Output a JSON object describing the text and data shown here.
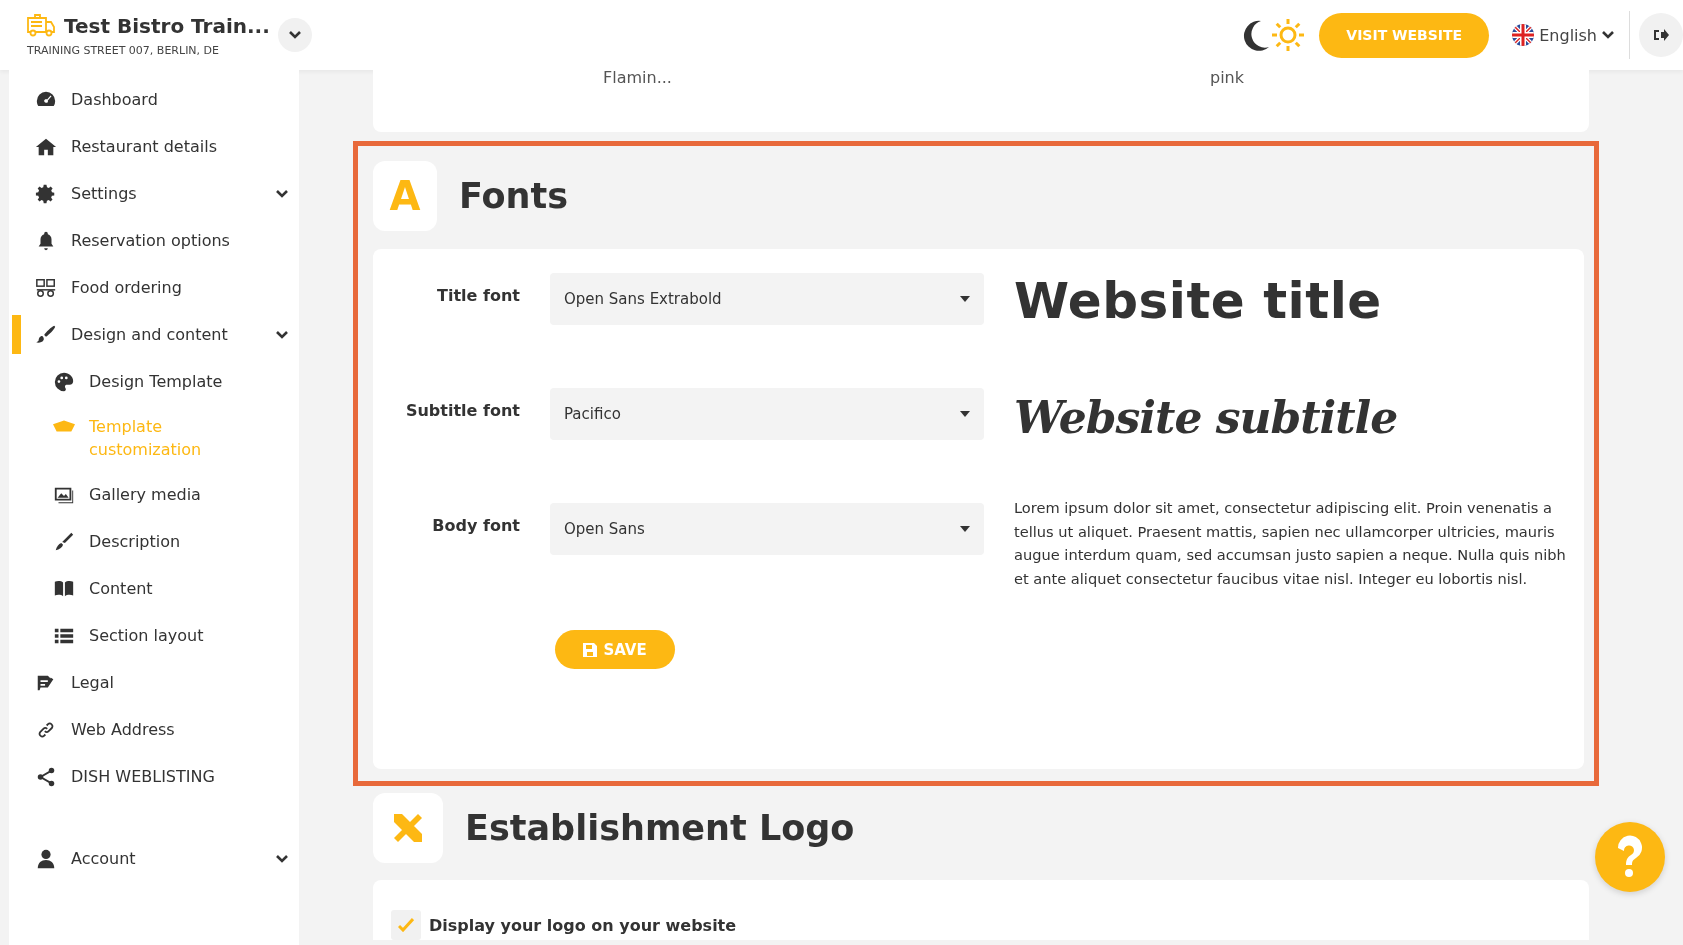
{
  "header": {
    "title": "Test Bistro Train...",
    "address": "TRAINING STREET 007, BERLIN, DE",
    "visit_button": "VISIT WEBSITE",
    "language": "English"
  },
  "sidebar": {
    "items": [
      {
        "label": "Dashboard",
        "selected": false,
        "dropdown": false
      },
      {
        "label": "Restaurant details",
        "selected": false,
        "dropdown": false
      },
      {
        "label": "Settings",
        "selected": false,
        "dropdown": true
      },
      {
        "label": "Reservation options",
        "selected": false,
        "dropdown": false
      },
      {
        "label": "Food ordering",
        "selected": false,
        "dropdown": false
      },
      {
        "label": "Design and content",
        "selected": true,
        "dropdown": true,
        "children": [
          {
            "label": "Design Template",
            "selected": false
          },
          {
            "label": "Template customization",
            "selected": true
          },
          {
            "label": "Gallery media",
            "selected": false
          },
          {
            "label": "Description",
            "selected": false
          },
          {
            "label": "Content",
            "selected": false
          },
          {
            "label": "Section layout",
            "selected": false
          }
        ]
      },
      {
        "label": "Legal",
        "selected": false,
        "dropdown": false
      },
      {
        "label": "Web Address",
        "selected": false,
        "dropdown": false
      },
      {
        "label": "DISH WEBLISTING",
        "selected": false,
        "dropdown": false
      }
    ],
    "account": {
      "label": "Account",
      "selected": false,
      "dropdown": true
    }
  },
  "previous_card": {
    "column_1": "Flamin...",
    "column_2": "pink"
  },
  "fonts_section": {
    "icon_letter": "A",
    "title": "Fonts",
    "highlighted": true,
    "rows": [
      {
        "label": "Title font",
        "value": "Open Sans Extrabold",
        "kind": "title",
        "preview": "Website title"
      },
      {
        "label": "Subtitle font",
        "value": "Pacifico",
        "kind": "subtitle",
        "preview": "Website subtitle"
      },
      {
        "label": "Body font",
        "value": "Open Sans",
        "kind": "body",
        "preview": "Lorem ipsum dolor sit amet, consectetur adipiscing elit. Proin venenatis a tellus ut aliquet. Praesent mattis, sapien nec ullamcorper ultricies, mauris augue interdum quam, sed accumsan justo sapien a neque. Nulla quis nibh et ante aliquet consectetur faucibus vitae nisl. Integer eu lobortis nisl."
      }
    ],
    "save_button": "SAVE"
  },
  "logo_section": {
    "title": "Establishment Logo",
    "checkbox": {
      "label": "Display your logo on your website",
      "checked": true
    }
  }
}
